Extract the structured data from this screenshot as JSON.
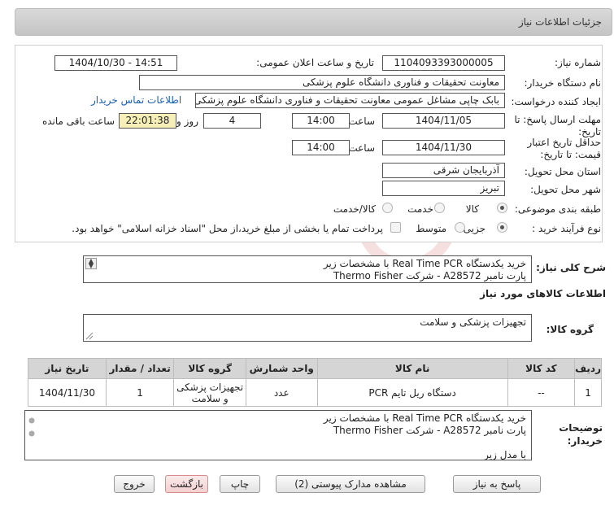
{
  "header": {
    "title": "جزئیات اطلاعات نیاز"
  },
  "form": {
    "need_number_label": "شماره نیاز:",
    "need_number": "1104093393000005",
    "announce_label": "تاریخ و ساعت اعلان عمومی:",
    "announce_value": "1404/10/30 - 14:51",
    "buyer_org_label": "نام دستگاه خریدار:",
    "buyer_org": "معاونت تحقیقات و فناوری دانشگاه علوم پزشکی",
    "requester_label": "ایجاد کننده درخواست:",
    "requester": "بابک چاپی مشاغل عمومی معاونت تحقیقات و فناوری دانشگاه علوم پزشکی",
    "contact_link": "اطلاعات تماس خریدار",
    "deadline_label_1": "مهلت ارسال پاسخ: تا",
    "deadline_label_2": "تاریخ:",
    "deadline_date": "1404/11/05",
    "time_label": "ساعت",
    "deadline_time": "14:00",
    "days_value": "4",
    "days_label": "روز و",
    "remaining_time": "22:01:38",
    "remaining_label": "ساعت باقی مانده",
    "validity_label_1": "حداقل تاریخ اعتبار",
    "validity_label_2": "قیمت: تا تاریخ:",
    "validity_date": "1404/11/30",
    "validity_time": "14:00",
    "province_label": "استان محل تحویل:",
    "province": "آذربایجان شرقی",
    "city_label": "شهر محل تحویل:",
    "city": "تبریز",
    "category_label": "طبقه بندی موضوعی:",
    "category_options": [
      "کالا",
      "خدمت",
      "کالا/خدمت"
    ],
    "category_selected": 0,
    "process_label": "نوع فرآیند خرید :",
    "process_options": [
      "جزیی",
      "متوسط"
    ],
    "process_selected": 0,
    "payment_note": "پرداخت تمام یا بخشی از مبلغ خرید،از محل \"اسناد خزانه اسلامی\" خواهد بود."
  },
  "summary": {
    "label": "شرح کلی نیاز:",
    "line1": "خرید یکدستگاه Real Time PCR با مشخصات زیر",
    "line2": "پارت نامبر A28572 - شرکت Thermo Fisher"
  },
  "goods": {
    "section_title": "اطلاعات کالاهای مورد نیاز",
    "group_label": "گروه کالا:",
    "group_value": "تجهیزات پزشکی و سلامت",
    "columns": [
      "ردیف",
      "کد کالا",
      "نام کالا",
      "واحد شمارش",
      "گروه کالا",
      "تعداد / مقدار",
      "تاریخ نیاز"
    ],
    "rows": [
      {
        "row": "1",
        "code": "--",
        "name": "دستگاه ریل تایم PCR",
        "unit": "عدد",
        "group": "تجهیزات پزشکی و سلامت",
        "qty": "1",
        "date": "1404/11/30"
      }
    ]
  },
  "buyer_notes": {
    "label_1": "توضیحات",
    "label_2": "خریدار:",
    "line1": "خرید یکدستگاه Real Time PCR با مشخصات زیر",
    "line2": "پارت نامبر A28572 - شرکت Thermo Fisher",
    "line3": "",
    "line4": "با مدل زیر"
  },
  "buttons": {
    "reply": "پاسخ به نیاز",
    "attachments": "مشاهده مدارک پیوستی (2)",
    "print": "چاپ",
    "back": "بازگشت",
    "exit": "خروج"
  },
  "watermark": {
    "text": "AriaTender.neT"
  }
}
